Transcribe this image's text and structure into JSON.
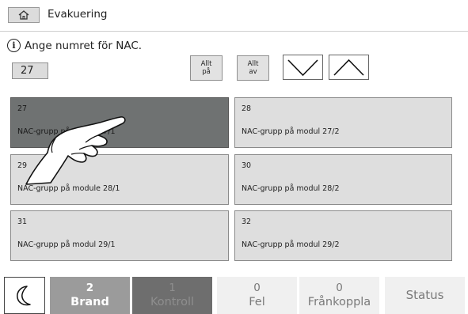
{
  "header": {
    "title": "Evakuering",
    "home_icon": "home-icon"
  },
  "prompt": {
    "text": "Ange numret för NAC.",
    "icon": "info-icon"
  },
  "nac_input": {
    "value": "27"
  },
  "controls": {
    "all_on": {
      "line1": "Allt",
      "line2": "på"
    },
    "all_off": {
      "line1": "Allt",
      "line2": "av"
    },
    "down_icon": "chevron-down-icon",
    "up_icon": "chevron-up-icon"
  },
  "tiles": [
    {
      "num": "27",
      "label": "NAC-grupp på modul 27/1",
      "selected": true
    },
    {
      "num": "28",
      "label": "NAC-grupp på modul 27/2",
      "selected": false
    },
    {
      "num": "29",
      "label": "NAC-grupp på module 28/1",
      "selected": false
    },
    {
      "num": "30",
      "label": "NAC-grupp på modul 28/2",
      "selected": false
    },
    {
      "num": "31",
      "label": "NAC-grupp på modul 29/1",
      "selected": false
    },
    {
      "num": "32",
      "label": "NAC-grupp på modul 29/2",
      "selected": false
    }
  ],
  "bottom_bar": {
    "moon_icon": "moon-icon",
    "brand": {
      "count": "2",
      "label": "Brand"
    },
    "kontroll": {
      "count": "1",
      "label": "Kontroll"
    },
    "fel": {
      "count": "0",
      "label": "Fel"
    },
    "frankoppla": {
      "count": "0",
      "label": "Frånkoppla"
    },
    "status": {
      "label": "Status"
    }
  },
  "colors": {
    "selected_tile": "#6f7272",
    "tile": "#dedede",
    "brand_tab": "#9b9b9b",
    "kontroll_tab": "#6e6e6e"
  }
}
